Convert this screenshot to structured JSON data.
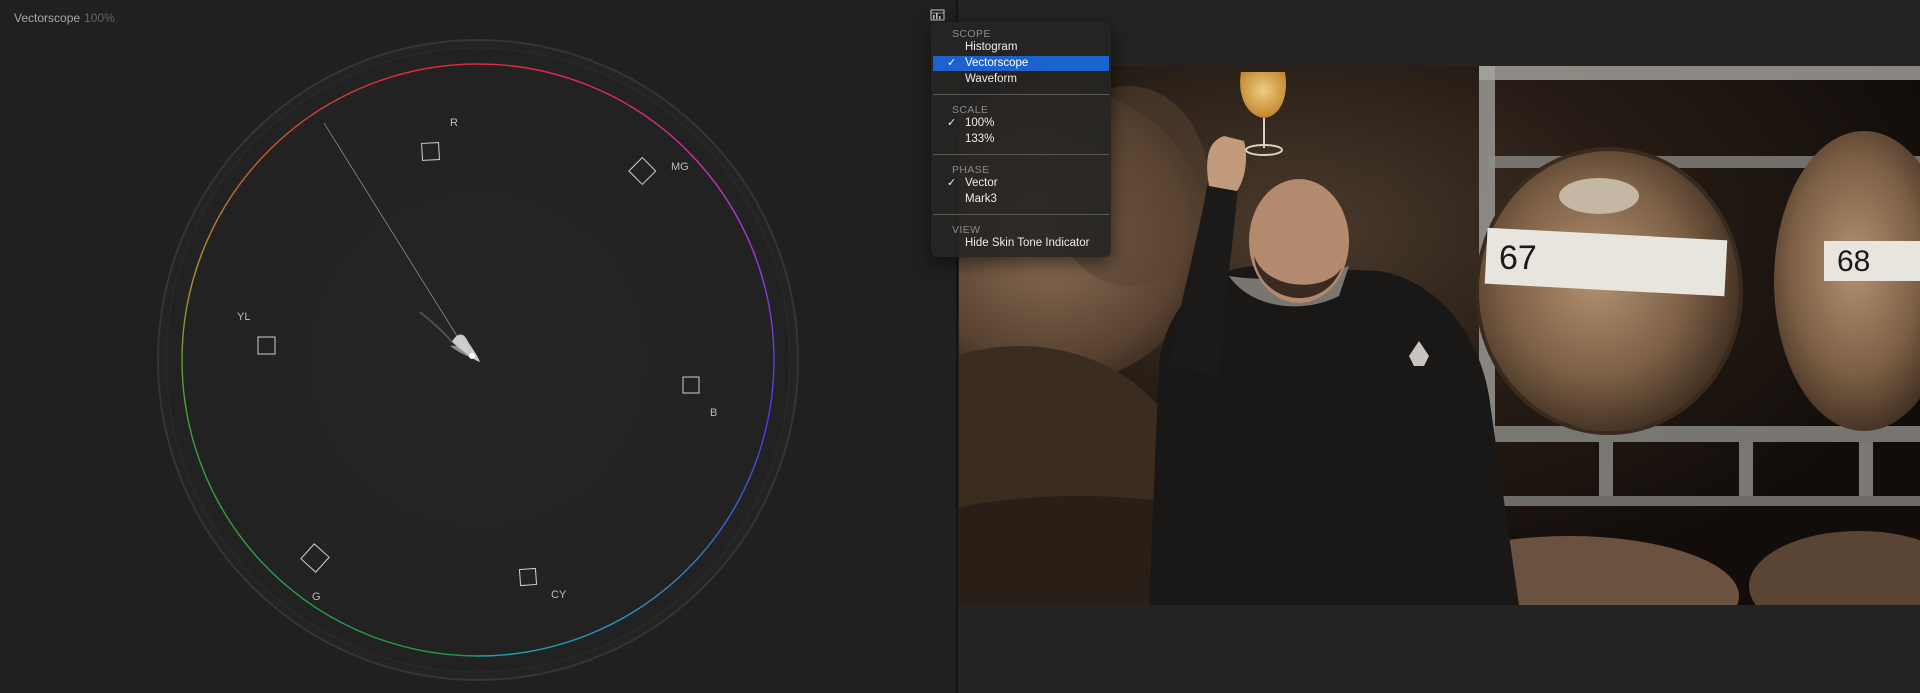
{
  "scope": {
    "title": "Vectorscope",
    "scale_label": "100%",
    "targets": [
      {
        "label": "R"
      },
      {
        "label": "MG"
      },
      {
        "label": "B"
      },
      {
        "label": "CY"
      },
      {
        "label": "G"
      },
      {
        "label": "YL"
      }
    ]
  },
  "menu": {
    "scope_header": "SCOPE",
    "scope_items": [
      "Histogram",
      "Vectorscope",
      "Waveform"
    ],
    "scope_selected": "Vectorscope",
    "scale_header": "SCALE",
    "scale_items": [
      "100%",
      "133%"
    ],
    "scale_selected": "100%",
    "phase_header": "PHASE",
    "phase_items": [
      "Vector",
      "Mark3"
    ],
    "phase_selected": "Vector",
    "view_header": "VIEW",
    "view_items": [
      "Hide Skin Tone Indicator"
    ]
  },
  "icons": {
    "settings": "scope-settings-icon",
    "check": "checkmark-icon"
  },
  "viewer": {
    "photo_subject": "man holding glass of beer in barrel room",
    "barrel_labels": [
      "67",
      "68"
    ]
  },
  "colors": {
    "menu_selection": "#1b62cf",
    "background": "#202020"
  }
}
